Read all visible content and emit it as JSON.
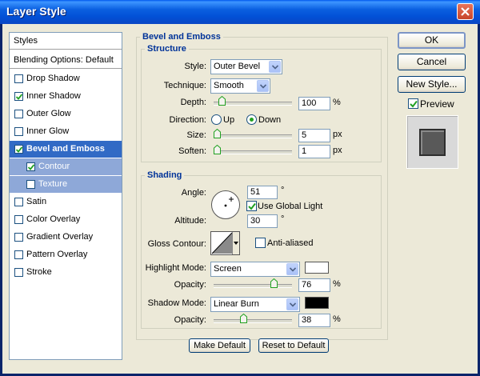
{
  "window": {
    "title": "Layer Style"
  },
  "styles_list": {
    "header": "Styles",
    "blending": "Blending Options: Default",
    "items": [
      {
        "label": "Drop Shadow",
        "checked": false
      },
      {
        "label": "Inner Shadow",
        "checked": true
      },
      {
        "label": "Outer Glow",
        "checked": false
      },
      {
        "label": "Inner Glow",
        "checked": false
      },
      {
        "label": "Bevel and Emboss",
        "checked": true
      },
      {
        "label": "Contour",
        "checked": true
      },
      {
        "label": "Texture",
        "checked": false
      },
      {
        "label": "Satin",
        "checked": false
      },
      {
        "label": "Color Overlay",
        "checked": false
      },
      {
        "label": "Gradient Overlay",
        "checked": false
      },
      {
        "label": "Pattern Overlay",
        "checked": false
      },
      {
        "label": "Stroke",
        "checked": false
      }
    ]
  },
  "bevel": {
    "title": "Bevel and Emboss",
    "structure": {
      "title": "Structure",
      "style_label": "Style:",
      "style_value": "Outer Bevel",
      "technique_label": "Technique:",
      "technique_value": "Smooth",
      "depth_label": "Depth:",
      "depth_value": "100",
      "depth_unit": "%",
      "direction_label": "Direction:",
      "dir_up": "Up",
      "dir_down": "Down",
      "size_label": "Size:",
      "size_value": "5",
      "size_unit": "px",
      "soften_label": "Soften:",
      "soften_value": "1",
      "soften_unit": "px"
    },
    "shading": {
      "title": "Shading",
      "angle_label": "Angle:",
      "angle_value": "51",
      "angle_unit": "°",
      "global_light": "Use Global Light",
      "altitude_label": "Altitude:",
      "altitude_value": "30",
      "altitude_unit": "°",
      "gloss_label": "Gloss Contour:",
      "anti_aliased": "Anti-aliased",
      "highlight_label": "Highlight Mode:",
      "highlight_value": "Screen",
      "highlight_color": "#ffffff",
      "hl_opacity_label": "Opacity:",
      "hl_opacity_value": "76",
      "shadow_label": "Shadow Mode:",
      "shadow_value": "Linear Burn",
      "shadow_color": "#000000",
      "sh_opacity_label": "Opacity:",
      "sh_opacity_value": "38",
      "pct": "%"
    },
    "make_default": "Make Default",
    "reset_default": "Reset to Default"
  },
  "buttons": {
    "ok": "OK",
    "cancel": "Cancel",
    "new_style": "New Style...",
    "preview": "Preview"
  },
  "colors": {
    "accent": "#316ac5",
    "legend": "#003399"
  }
}
